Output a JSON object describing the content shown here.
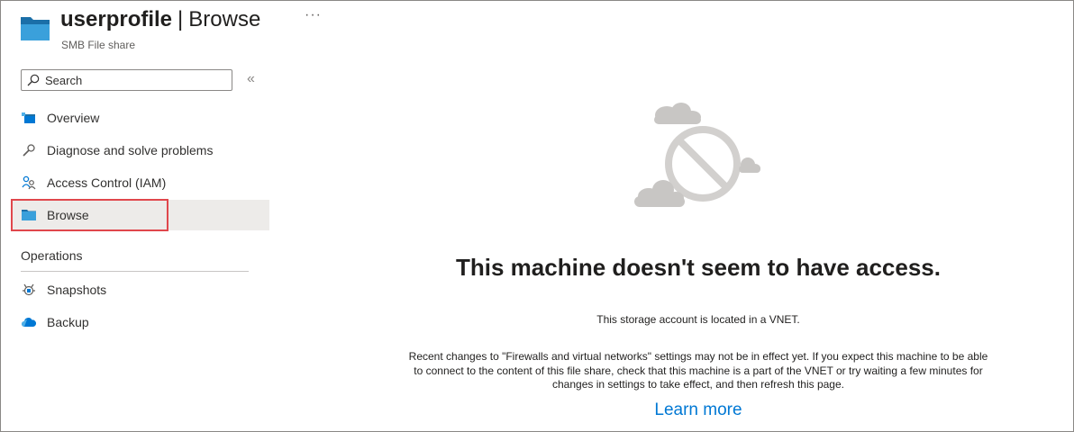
{
  "header": {
    "resource_name": "userprofile",
    "separator": "|",
    "page_name": "Browse",
    "more_label": "···",
    "subtitle": "SMB File share",
    "icon": "file-share-folder-icon"
  },
  "search": {
    "placeholder": "Search",
    "collapse_label": "«",
    "icon": "search-icon"
  },
  "nav": {
    "items": [
      {
        "label": "Overview",
        "icon": "overview-icon"
      },
      {
        "label": "Diagnose and solve problems",
        "icon": "wrench-icon"
      },
      {
        "label": "Access Control (IAM)",
        "icon": "people-icon"
      },
      {
        "label": "Browse",
        "icon": "folder-icon",
        "selected": true
      }
    ],
    "section": "Operations",
    "operations": [
      {
        "label": "Snapshots",
        "icon": "snapshot-icon"
      },
      {
        "label": "Backup",
        "icon": "backup-cloud-icon"
      }
    ]
  },
  "main": {
    "illustration": "no-access-cloud-icon",
    "headline": "This machine doesn't seem to have access.",
    "description": "This storage account is located in a VNET.",
    "paragraph_lines": [
      "Recent changes to \"Firewalls and virtual networks\" settings may not be in effect yet. If you expect this machine to be able",
      "to connect to the content of this file share, check that this machine is a part of the VNET or try waiting a few minutes for",
      "changes in settings to take effect, and then refresh this page."
    ],
    "learn_more": "Learn more"
  },
  "colors": {
    "accent": "#0078d4",
    "highlight_border": "#e0474c",
    "selected_bg": "#edebe9"
  }
}
